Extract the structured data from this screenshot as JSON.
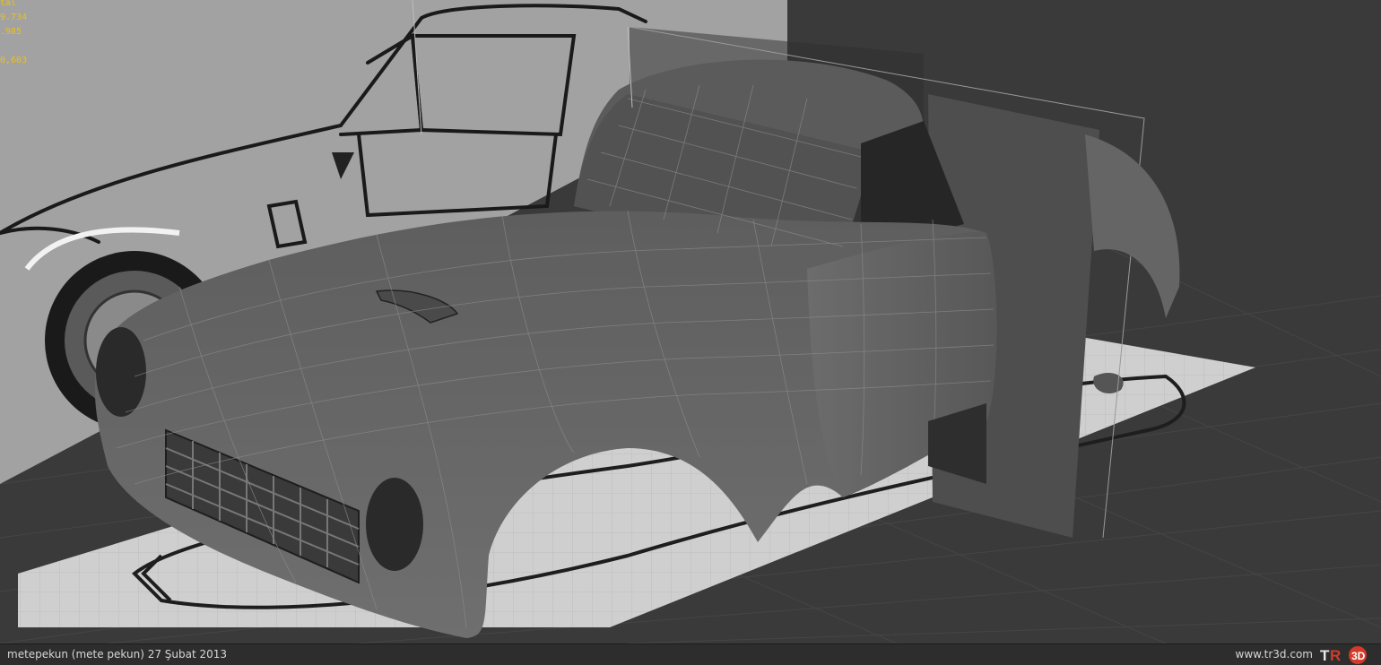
{
  "viewport": {
    "stats": {
      "line1": "tal",
      "line2": "9.734",
      "line3": ".985",
      "line4": "0,603"
    },
    "stats_color": "#e8c020",
    "background_color": "#3a3a3a",
    "model_color": "#6a6a6a"
  },
  "footer": {
    "credit": "metepekun (mete pekun)  27 Şubat 2013",
    "site": "www.tr3d.com",
    "logo_icon": "tr3d-logo"
  }
}
